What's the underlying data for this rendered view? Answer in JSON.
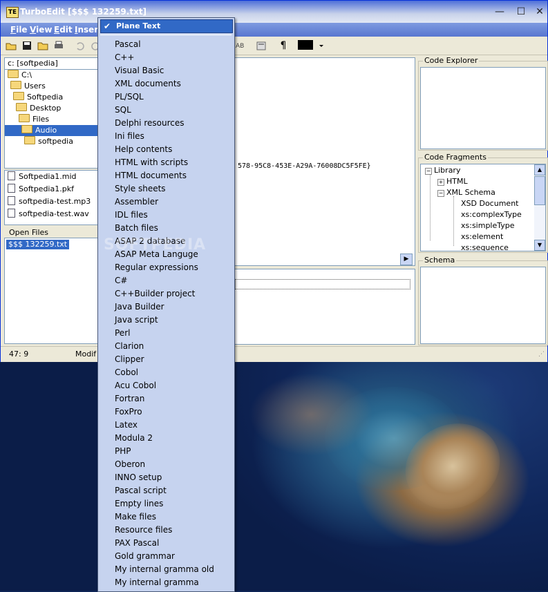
{
  "window": {
    "title": "TurboEdit [$$$ 132259.txt]",
    "app_icon_text": "TE",
    "controls": {
      "minimize": "—",
      "maximize": "☐",
      "close": "✕"
    }
  },
  "menubar": {
    "file": "File",
    "view": "View",
    "edit": "Edit",
    "insert": "Insert"
  },
  "toolbar": {
    "pilcrow": "¶"
  },
  "left_panel": {
    "path": "c: [softpedia]",
    "tree": [
      {
        "label": "C:\\",
        "indent": 0
      },
      {
        "label": "Users",
        "indent": 1
      },
      {
        "label": "Softpedia",
        "indent": 2
      },
      {
        "label": "Desktop",
        "indent": 3
      },
      {
        "label": "Files",
        "indent": 4
      },
      {
        "label": "Audio",
        "indent": 5,
        "selected": true
      },
      {
        "label": "softpedia",
        "indent": 6
      }
    ],
    "files": [
      "Softpedia1.mid",
      "Softpedia1.pkf",
      "softpedia-test.mp3",
      "softpedia-test.wav"
    ],
    "open_files_label": "Open Files",
    "open_files": [
      "$$$ 132259.txt"
    ]
  },
  "editor": {
    "visible_text": "578-95C8-453E-A29A-76008DC5F5FE}",
    "scroll_arrow": "▶"
  },
  "right_panel": {
    "code_explorer_label": "Code Explorer",
    "code_fragments_label": "Code Fragments",
    "code_fragments": {
      "library": "Library",
      "html": "HTML",
      "xml_schema": "XML Schema",
      "xsd_document": "XSD Document",
      "complex_type": "xs:complexType",
      "simple_type": "xs:simpleType",
      "element": "xs:element",
      "sequence": "xs:sequence"
    },
    "schema_label": "Schema"
  },
  "statusbar": {
    "position": "47: 9",
    "modified": "Modif"
  },
  "language_menu": {
    "checked_item": "Plane Text",
    "check_mark": "✔",
    "items": [
      "Pascal",
      "C++",
      "Visual Basic",
      "XML documents",
      "PL/SQL",
      "SQL",
      "Delphi resources",
      "Ini files",
      "Help contents",
      "HTML with scripts",
      "HTML documents",
      "Style sheets",
      "Assembler",
      "IDL files",
      "Batch files",
      "ASAP 2 database",
      "ASAP Meta Languge",
      "Regular expressions",
      "C#",
      "C++Builder project",
      "Java Builder",
      "Java script",
      "Perl",
      "Clarion",
      "Clipper",
      "Cobol",
      "Acu Cobol",
      "Fortran",
      "FoxPro",
      "Latex",
      "Modula 2",
      "PHP",
      "Oberon",
      "INNO setup",
      "Pascal script",
      "Empty lines",
      "Make files",
      "Resource files",
      "PAX Pascal",
      "Gold grammar",
      "My internal gramma old",
      "My internal gramma"
    ]
  },
  "watermark": "SOFTPEDIA",
  "colors": {
    "selection": "#3169c6",
    "menu_bg": "#c6d3ef",
    "titlebar": "#4e6fd8"
  }
}
